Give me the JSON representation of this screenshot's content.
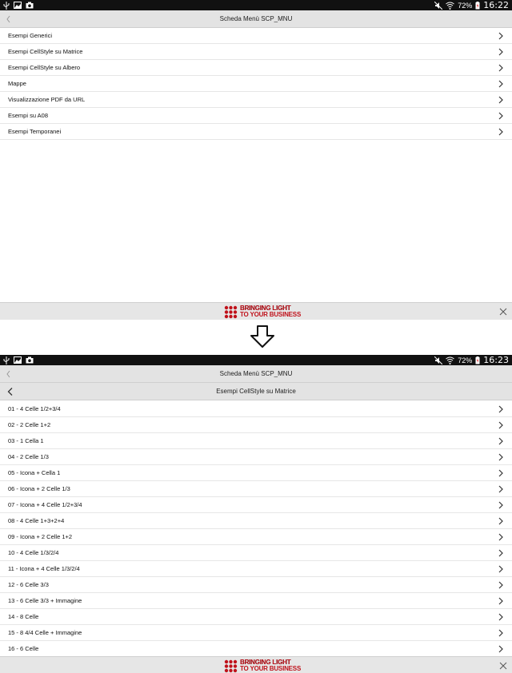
{
  "screen1": {
    "status": {
      "battery": "72%",
      "time": "16:22"
    },
    "title": "Scheda Menù SCP_MNU",
    "items": [
      "Esempi Generici",
      "Esempi CellStyle su Matrice",
      "Esempi CellStyle su Albero",
      "Mappe",
      "Visualizzazione PDF da URL",
      "Esempi su A08",
      "Esempi Temporanei"
    ]
  },
  "banner": {
    "line1": "BRINGING LIGHT",
    "line2": "TO YOUR BUSINESS"
  },
  "screen2": {
    "status": {
      "battery": "72%",
      "time": "16:23"
    },
    "title": "Scheda Menù SCP_MNU",
    "subtitle": "Esempi CellStyle su Matrice",
    "items": [
      "01 - 4 Celle 1/2+3/4",
      "02 - 2 Celle 1+2",
      "03 - 1 Cella 1",
      "04 - 2 Celle 1/3",
      "05 - Icona + Cella 1",
      "06 - Icona + 2 Celle 1/3",
      "07 - Icona + 4 Celle 1/2+3/4",
      "08 - 4 Celle 1+3+2+4",
      "09 - Icona + 2 Celle 1+2",
      "10 - 4 Celle 1/3/2/4",
      "11 - Icona + 4 Celle 1/3/2/4",
      "12 - 6 Celle 3/3",
      "13 - 6 Celle 3/3 + Immagine",
      "14 - 8 Celle",
      "15 - 8 4/4 Celle + Immagine",
      "16 - 6 Celle"
    ]
  },
  "icons": {
    "status_left": [
      "usb-icon",
      "image-icon",
      "camera-icon"
    ],
    "status_right": [
      "mute-icon",
      "wifi-icon",
      "battery-icon"
    ],
    "back": "back-chevron-icon",
    "row": "chevron-right-icon",
    "close": "close-icon",
    "transition": "down-arrow-icon"
  },
  "colors": {
    "statusbar": "#111111",
    "titlebar": "#e3e3e3",
    "banner_text": "#c0121b"
  }
}
